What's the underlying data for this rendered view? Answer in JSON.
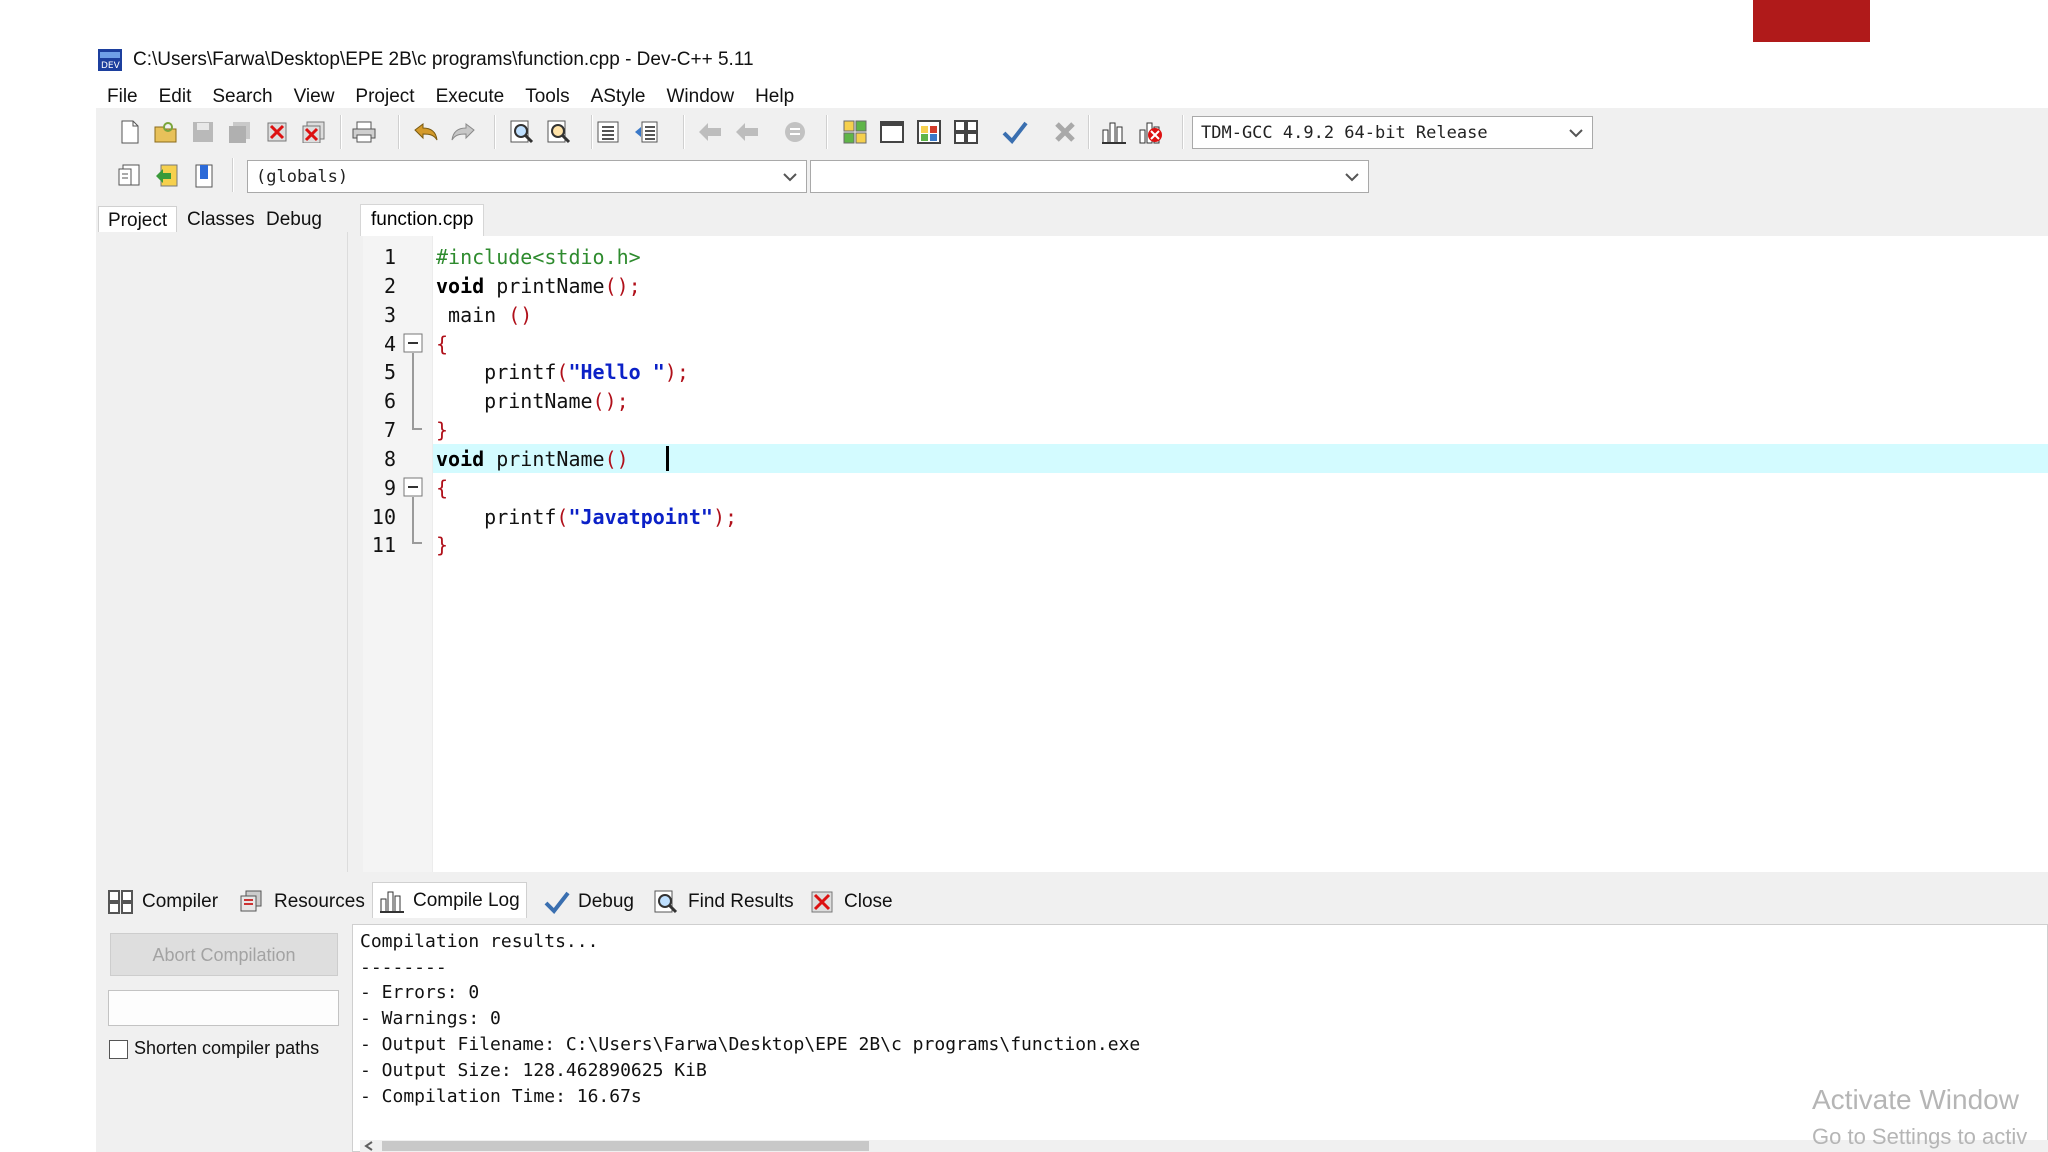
{
  "window": {
    "title": "C:\\Users\\Farwa\\Desktop\\EPE 2B\\c programs\\function.cpp - Dev-C++ 5.11"
  },
  "menu": [
    "File",
    "Edit",
    "Search",
    "View",
    "Project",
    "Execute",
    "Tools",
    "AStyle",
    "Window",
    "Help"
  ],
  "toolbar": {
    "compiler_select": "TDM-GCC 4.9.2 64-bit Release",
    "scope_select": "(globals)",
    "member_select": ""
  },
  "left_tabs": [
    "Project",
    "Classes",
    "Debug"
  ],
  "editor": {
    "file_tab": "function.cpp",
    "line_numbers": [
      "1",
      "2",
      "3",
      "4",
      "5",
      "6",
      "7",
      "8",
      "9",
      "10",
      "11"
    ],
    "current_line": 8
  },
  "bottom_tabs": [
    "Compiler",
    "Resources",
    "Compile Log",
    "Debug",
    "Find Results",
    "Close"
  ],
  "bottom_active_tab": "Compile Log",
  "compile_panel": {
    "abort_label": "Abort Compilation",
    "shorten_label": "Shorten compiler paths",
    "shorten_checked": false
  },
  "log": [
    "Compilation results...",
    "--------",
    "- Errors: 0",
    "- Warnings: 0",
    "- Output Filename: C:\\Users\\Farwa\\Desktop\\EPE 2B\\c programs\\function.exe",
    "- Output Size: 128.462890625 KiB",
    "- Compilation Time: 16.67s"
  ],
  "watermark": {
    "line1": "Activate Window",
    "line2": "Go to Settings to activ"
  },
  "colors": {
    "current_line": "#d3fbff",
    "keyword_symbol": "#b0101a",
    "string": "#0b21c7",
    "preprocessor": "#2e8b2e"
  }
}
